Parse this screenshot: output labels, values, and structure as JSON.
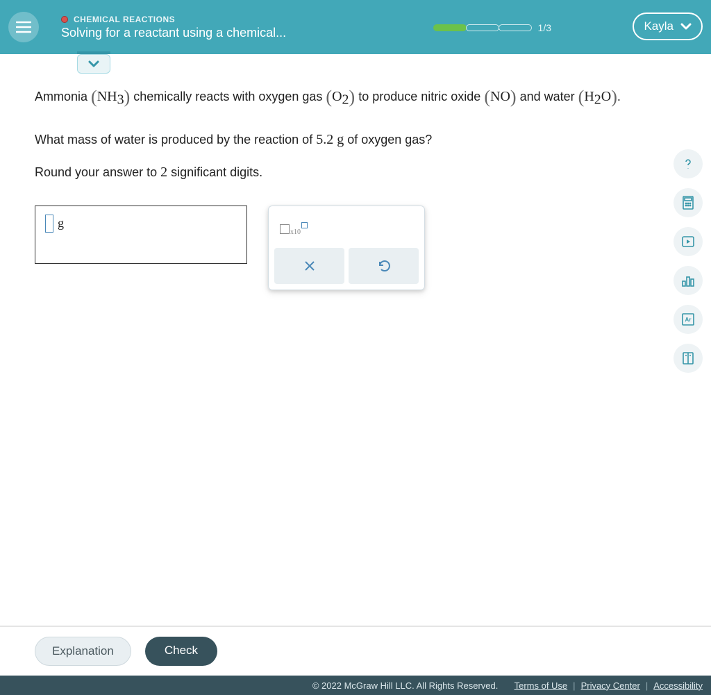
{
  "header": {
    "course": "CHEMICAL REACTIONS",
    "title": "Solving for a reactant using a chemical...",
    "progress": {
      "filled": 1,
      "total": 3,
      "label": "1/3"
    },
    "user": "Kayla"
  },
  "question": {
    "t1": "Ammonia ",
    "f1": "NH",
    "f1sub": "3",
    "t2": " chemically reacts with oxygen gas ",
    "f2": "O",
    "f2sub": "2",
    "t3": " to produce nitric oxide ",
    "f3": "NO",
    "t4": " and water ",
    "f4a": "H",
    "f4sub": "2",
    "f4b": "O",
    "t5": ".",
    "line2a": "What mass of water is produced by the reaction of ",
    "mass": "5.2 g",
    "line2b": " of oxygen gas?",
    "line3a": "Round your answer to ",
    "sig": "2",
    "line3b": " significant digits."
  },
  "answer": {
    "unit": "g",
    "value": ""
  },
  "keypad": {
    "sci_label": "x10"
  },
  "buttons": {
    "explanation": "Explanation",
    "check": "Check"
  },
  "footer": {
    "copyright": "© 2022 McGraw Hill LLC. All Rights Reserved.",
    "terms": "Terms of Use",
    "privacy": "Privacy Center",
    "access": "Accessibility"
  },
  "tools": [
    "help",
    "calculator",
    "video",
    "stats",
    "periodic",
    "reference"
  ]
}
